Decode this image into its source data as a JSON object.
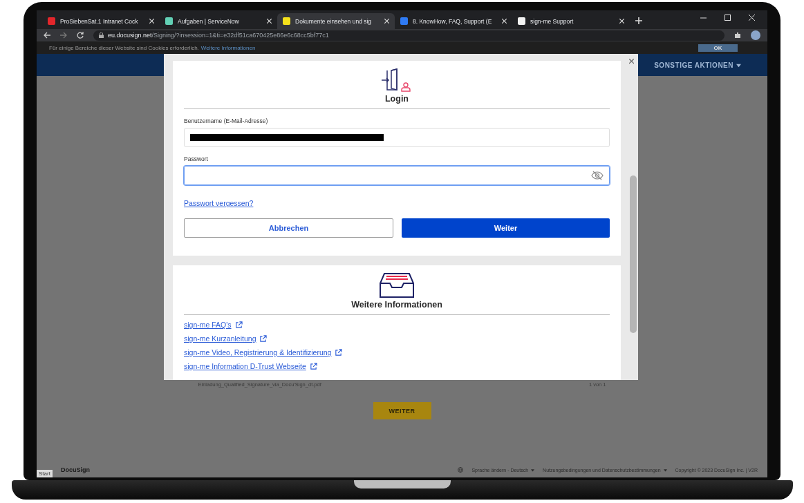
{
  "browser": {
    "tabs": [
      {
        "label": "ProSiebenSat.1 Intranet Cock",
        "selected": false,
        "color": "#e3262b"
      },
      {
        "label": "Aufgaben | ServiceNow",
        "selected": false,
        "color": "#62d0b5"
      },
      {
        "label": "Dokumente einsehen und sig",
        "selected": true,
        "color": "#f5e11b"
      },
      {
        "label": "8. KnowHow, FAQ, Support (E",
        "selected": false,
        "color": "#2f7bf5"
      },
      {
        "label": "sign-me Support",
        "selected": false,
        "color": "#f2f2f2"
      }
    ],
    "url_host": "eu.docusign.net",
    "url_path": "/Signing/?insession=1&ti=e32df51ca670425e86e6c68cc5bf77c1"
  },
  "cookie_bar": {
    "text": "Für einige Bereiche dieser Website sind Cookies erforderlich.",
    "link": "Weitere Informationen",
    "button": "OK"
  },
  "header": {
    "menu": "SONSTIGE AKTIONEN"
  },
  "document": {
    "filename": "Einladung_Qualified_Signature_via_Docu'Sign_dt.pdf",
    "pages": "1 von 1",
    "button": "WEITER"
  },
  "dialog": {
    "login": {
      "title": "Login",
      "username_label": "Benutzername (E-Mail-Adresse)",
      "password_label": "Passwort",
      "password_focused": true,
      "forgot": "Passwort vergessen?",
      "cancel": "Abbrechen",
      "submit": "Weiter"
    },
    "info": {
      "title": "Weitere Informationen",
      "links": [
        "sign-me FAQ's",
        "sign-me Kurzanleitung",
        "sign-me Video, Registrierung & Identifizierung",
        "sign-me Information D-Trust Webseite"
      ]
    }
  },
  "footer": {
    "start": "Start",
    "brand": "DocuSign",
    "language": "Sprache ändern - Deutsch",
    "terms": "Nutzungsbedingungen und Datenschutzbestimmungen",
    "copyright": "Copyright © 2023 DocuSign Inc. | V2R"
  }
}
